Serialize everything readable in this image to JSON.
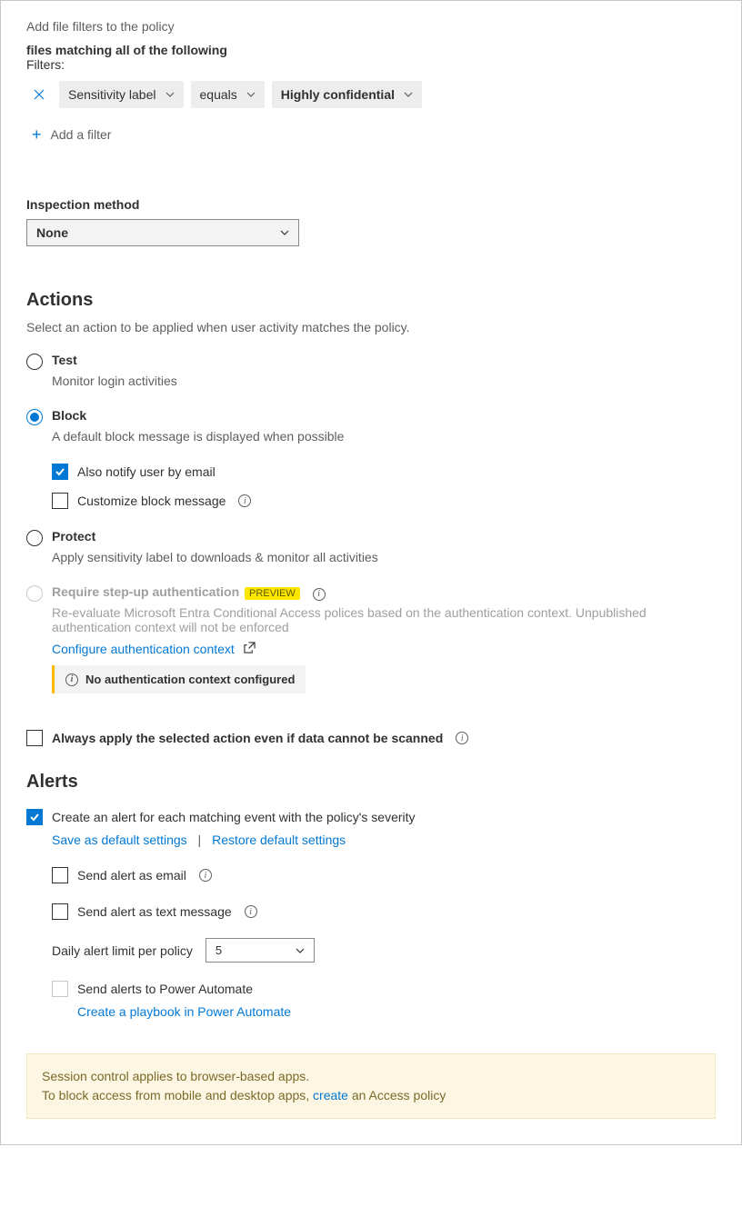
{
  "header": {
    "add_filters": "Add file filters to the policy",
    "files_matching": "files matching all of the following",
    "filters_label": "Filters:"
  },
  "filter": {
    "remove_title": "Remove filter",
    "field": "Sensitivity label",
    "operator": "equals",
    "value": "Highly confidential",
    "add_filter": "Add a filter"
  },
  "inspection": {
    "label": "Inspection method",
    "value": "None"
  },
  "actions": {
    "heading": "Actions",
    "helper": "Select an action to be applied when user activity matches the policy.",
    "test": {
      "label": "Test",
      "desc": "Monitor login activities"
    },
    "block": {
      "label": "Block",
      "desc": "A default block message is displayed when possible",
      "notify_email": "Also notify user by email",
      "customize": "Customize block message"
    },
    "protect": {
      "label": "Protect",
      "desc": "Apply sensitivity label to downloads & monitor all activities"
    },
    "stepup": {
      "label": "Require step-up authentication",
      "badge": "PREVIEW",
      "desc": "Re-evaluate Microsoft Entra Conditional Access polices based on the authentication context. Unpublished authentication context will not be enforced",
      "configure_link": "Configure authentication context",
      "warn": "No authentication context configured"
    },
    "always_apply": "Always apply the selected action even if data cannot be scanned"
  },
  "alerts": {
    "heading": "Alerts",
    "create_alert": "Create an alert for each matching event with the policy's severity",
    "save_default": "Save as default settings",
    "restore_default": "Restore default settings",
    "send_email": "Send alert as email",
    "send_text": "Send alert as text message",
    "limit_label": "Daily alert limit per policy",
    "limit_value": "5",
    "power_automate": "Send alerts to Power Automate",
    "playbook_link": "Create a playbook in Power Automate"
  },
  "footer": {
    "line1": "Session control applies to browser-based apps.",
    "line2a": "To block access from mobile and desktop apps, ",
    "create": "create",
    "line2b": " an Access policy"
  }
}
